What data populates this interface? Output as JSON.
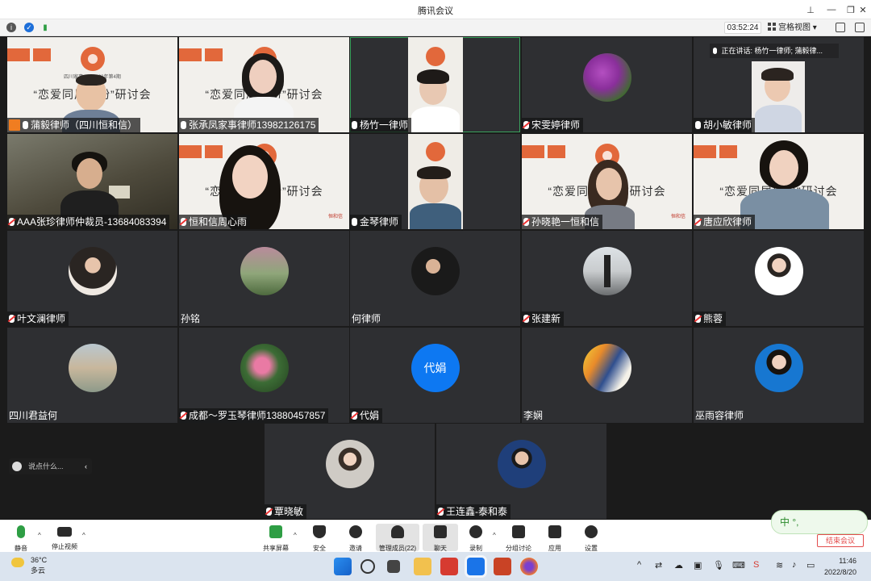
{
  "window": {
    "title": "腾讯会议"
  },
  "toolbar": {
    "timer": "03:52:24",
    "view_label": "宫格视图"
  },
  "speaking": {
    "text": "正在讲话: 杨竹一律师; 蒲毅律..."
  },
  "banner": {
    "small_text": "四川家事……2022年第4期",
    "headline": "“恋爱同居纠纷”研讨会",
    "footer_text": "恒和信"
  },
  "participants": [
    {
      "name": "蒲毅律师（四川恒和信）",
      "host": true
    },
    {
      "name": "张承凤家事律师13982126175"
    },
    {
      "name": "杨竹一律师"
    },
    {
      "name": "宋雯婷律师"
    },
    {
      "name": "胡小敏律师"
    },
    {
      "name": "AAA张珍律师仲裁员-13684083394"
    },
    {
      "name": "恒和信周心雨"
    },
    {
      "name": "金琴律师"
    },
    {
      "name": "孙晓艳一恒和信"
    },
    {
      "name": "唐应欣律师"
    },
    {
      "name": "叶文澜律师"
    },
    {
      "name": "孙铭"
    },
    {
      "name": "何律师"
    },
    {
      "name": "张建新"
    },
    {
      "name": "熊蓉"
    },
    {
      "name": "四川君益何"
    },
    {
      "name": "成都～罗玉琴律师13880457857"
    },
    {
      "name": "代娟",
      "avatar_text": "代娟"
    },
    {
      "name": "李娴"
    },
    {
      "name": "巫雨容律师"
    },
    {
      "name": "覃晓敏"
    },
    {
      "name": "王连鑫-泰和泰"
    }
  ],
  "chat": {
    "placeholder": "说点什么..."
  },
  "bottom_bar": {
    "mute": "静音",
    "stop_video": "停止视频",
    "share_screen": "共享屏幕",
    "security": "安全",
    "invite": "邀请",
    "manage_members": "管理成员(22)",
    "chat": "聊天",
    "record": "录制",
    "breakout": "分组讨论",
    "apps": "应用",
    "settings": "设置",
    "end_meeting": "结束会议"
  },
  "ime": {
    "text": "中 °,"
  },
  "taskbar": {
    "temperature": "36°C",
    "weather": "多云",
    "time": "11:46",
    "date": "2022/8/20"
  },
  "colors": {
    "accent_orange": "#e2683b",
    "avatar_blue": "#0d78f2",
    "active_green": "#3aa35d",
    "end_red": "#e34d4d"
  }
}
